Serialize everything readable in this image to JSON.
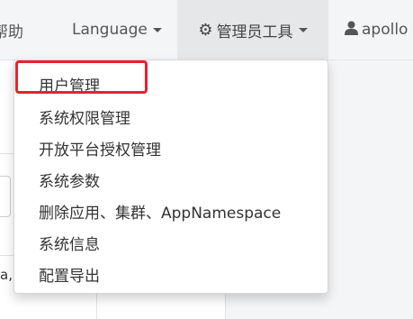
{
  "navbar": {
    "help_label": "帮助",
    "language_label": "Language",
    "admin_tools_label": "管理员工具",
    "user_label": "apollo"
  },
  "dropdown": {
    "items": [
      {
        "label": "用户管理"
      },
      {
        "label": "系统权限管理"
      },
      {
        "label": "开放平台授权管理"
      },
      {
        "label": "系统参数"
      },
      {
        "label": "删除应用、集群、AppNamespace"
      },
      {
        "label": "系统信息"
      },
      {
        "label": "配置导出"
      }
    ],
    "highlighted_item_index": 0
  },
  "background": {
    "text_fragment": "a,"
  },
  "colors": {
    "navbar_bg": "#f4f5f7",
    "active_nav_bg": "#e6e7e9",
    "highlight_border": "#e8212e"
  },
  "icons": {
    "admin_tools": "gear-icon",
    "user": "user-icon",
    "dropdown_caret": "caret-down-icon"
  }
}
